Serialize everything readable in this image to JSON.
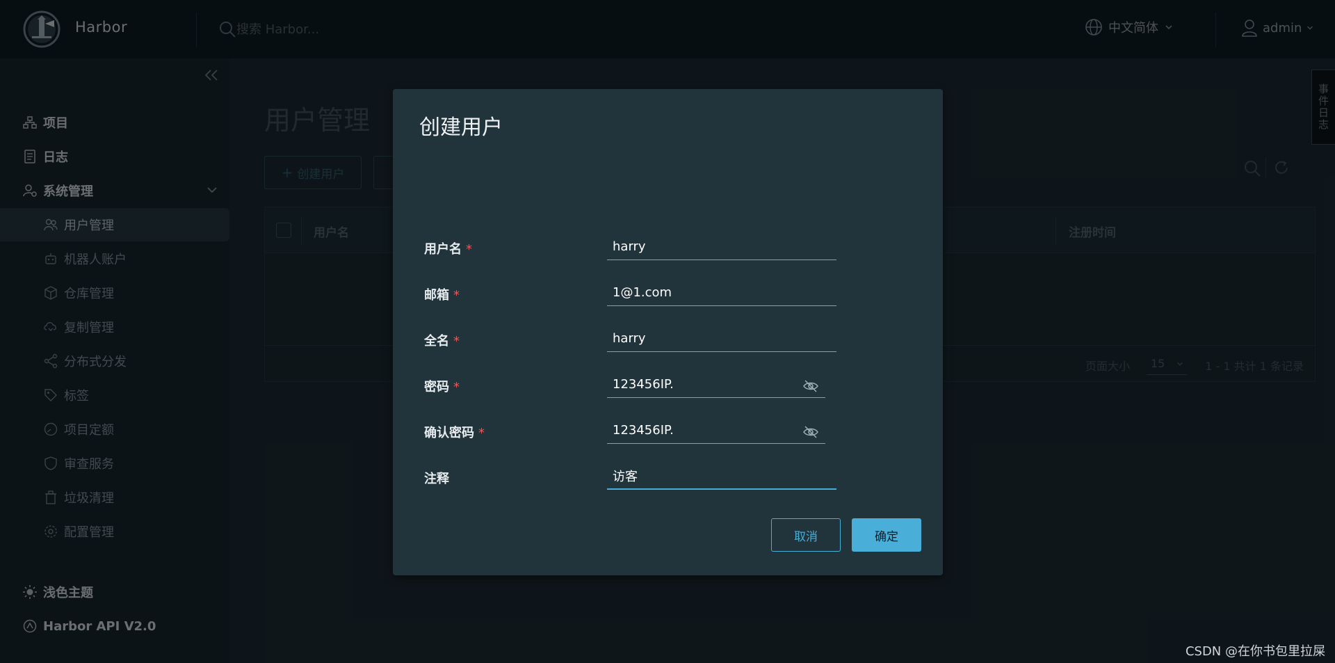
{
  "header": {
    "brand": "Harbor",
    "search_placeholder": "搜索 Harbor...",
    "language": "中文简体",
    "user": "admin"
  },
  "side_tab": "事件日志",
  "sidebar": {
    "items": [
      {
        "label": "项目",
        "icon": "projects-icon"
      },
      {
        "label": "日志",
        "icon": "logs-icon"
      },
      {
        "label": "系统管理",
        "icon": "admin-icon"
      }
    ],
    "sub_items": [
      {
        "label": "用户管理",
        "icon": "users-icon",
        "active": true
      },
      {
        "label": "机器人账户",
        "icon": "robot-icon"
      },
      {
        "label": "仓库管理",
        "icon": "registry-icon"
      },
      {
        "label": "复制管理",
        "icon": "replication-icon"
      },
      {
        "label": "分布式分发",
        "icon": "distribution-icon"
      },
      {
        "label": "标签",
        "icon": "tag-icon"
      },
      {
        "label": "项目定额",
        "icon": "quota-icon"
      },
      {
        "label": "审查服务",
        "icon": "shield-icon"
      },
      {
        "label": "垃圾清理",
        "icon": "trash-icon"
      },
      {
        "label": "配置管理",
        "icon": "gear-icon"
      }
    ],
    "theme_toggle": "浅色主题",
    "api_link": "Harbor API V2.0"
  },
  "main": {
    "title": "用户管理",
    "create_button": "创建用户",
    "grid": {
      "columns": [
        "用户名",
        "注册时间"
      ],
      "page_size_label": "页面大小",
      "page_size": "15",
      "count": "1 - 1 共计 1 条记录"
    }
  },
  "modal": {
    "title": "创建用户",
    "fields": {
      "username": {
        "label": "用户名",
        "value": "harry"
      },
      "email": {
        "label": "邮箱",
        "value": "1@1.com"
      },
      "fullname": {
        "label": "全名",
        "value": "harry"
      },
      "password": {
        "label": "密码",
        "value": "123456IP."
      },
      "confirm": {
        "label": "确认密码",
        "value": "123456IP."
      },
      "comment": {
        "label": "注释",
        "value": "访客"
      }
    },
    "cancel": "取消",
    "ok": "确定"
  },
  "watermark": "CSDN @在你书包里拉屎",
  "colors": {
    "accent": "#49afd9",
    "required": "#e25d5d",
    "header_bg": "#0f1b22",
    "modal_bg": "#21333b"
  }
}
